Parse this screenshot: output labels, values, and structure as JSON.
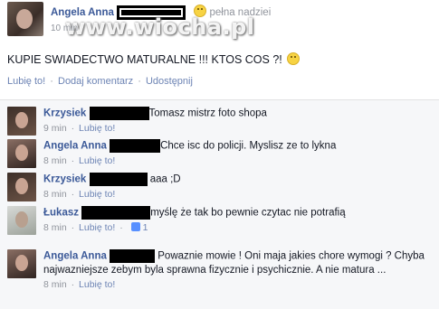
{
  "post": {
    "author": "Angela Anna",
    "feeling_text": "pełna nadziei",
    "time": "10 min",
    "watermark": "www.wiocha.pl",
    "text": "KUPIE SWIADECTWO MATURALNE !!! KTOS COS ?!",
    "actions": {
      "like": "Lubię to!",
      "comment": "Dodaj komentarz",
      "share": "Udostępnij",
      "separator": "·"
    }
  },
  "comments": [
    {
      "author": "Krzysiek",
      "text": "Tomasz mistrz foto shopa",
      "time": "9 min",
      "like": "Lubię to!"
    },
    {
      "author": "Angela Anna",
      "text": "Chce isc do policji. Myslisz ze to lykna",
      "time": "8 min",
      "like": "Lubię to!"
    },
    {
      "author": "Krzysiek",
      "text": "aaa ;D",
      "time": "8 min",
      "like": "Lubię to!"
    },
    {
      "author": "Łukasz",
      "text": "myślę że tak bo pewnie czytac nie potrafią",
      "time": "8 min",
      "like": "Lubię to!",
      "like_count": "1"
    },
    {
      "author": "Angela Anna",
      "text": "Powaznie mowie ! Oni maja jakies chore wymogi ? Chyba najwazniejsze zebym byla sprawna fizycznie i psychicznie. A nie matura ...",
      "time": "8 min",
      "like": "Lubię to!"
    }
  ],
  "meta": {
    "separator": "·"
  }
}
